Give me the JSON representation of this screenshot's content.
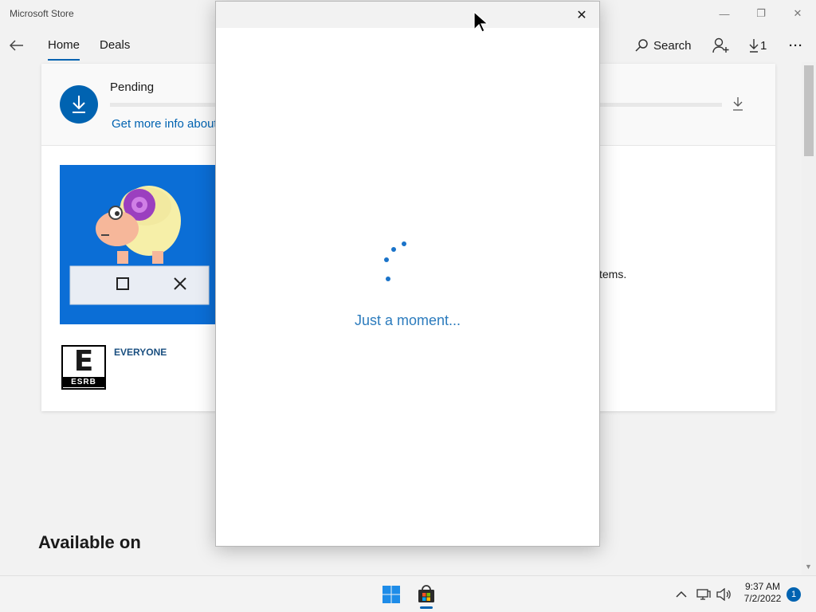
{
  "window": {
    "title": "Microsoft Store",
    "controls": {
      "minimize": "—",
      "restore": "❐",
      "close": "✕"
    }
  },
  "nav": {
    "tabs": [
      {
        "label": "Home",
        "selected": true
      },
      {
        "label": "Deals",
        "selected": false
      }
    ],
    "search_label": "Search",
    "downloads_count": "1",
    "more": "···"
  },
  "pending": {
    "status": "Pending",
    "link": "Get more info about"
  },
  "product": {
    "rating_letter": "E",
    "rating_org": "ESRB",
    "rating_label": "EVERYONE",
    "description_fragment": "tems."
  },
  "section": {
    "available_on": "Available on"
  },
  "dialog": {
    "close": "✕",
    "message": "Just a moment..."
  },
  "taskbar": {
    "time": "9:37 AM",
    "date": "7/2/2022",
    "notification_count": "1"
  },
  "colors": {
    "accent": "#0063b1",
    "link": "#2b7bbd",
    "hero_bg": "#0b6ed6"
  }
}
